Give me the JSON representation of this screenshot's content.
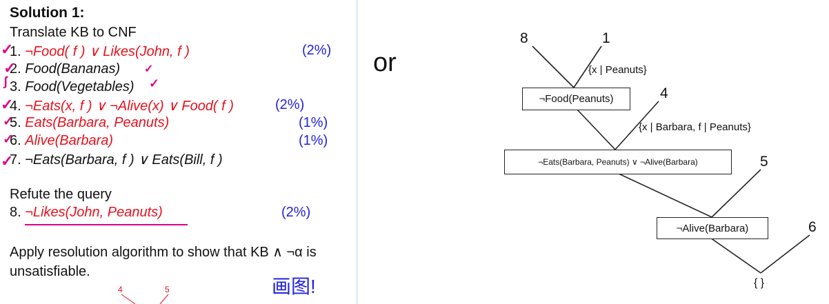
{
  "left": {
    "title": "Solution 1:",
    "subtitle": "Translate KB to CNF",
    "clauses": [
      {
        "num": "1. ",
        "text": "¬Food( f ) ∨ Likes(John, f )",
        "pct": "(2%)"
      },
      {
        "num": "2. ",
        "text": "Food(Bananas)"
      },
      {
        "num": "3. ",
        "text": "Food(Vegetables)"
      },
      {
        "num": "4. ",
        "text": "¬Eats(x, f ) ∨ ¬Alive(x) ∨ Food( f )",
        "pct": "(2%)"
      },
      {
        "num": "5. ",
        "text": "Eats(Barbara, Peanuts)",
        "pct": "(1%)"
      },
      {
        "num": "6. ",
        "text": "Alive(Barbara)",
        "pct": "(1%)"
      },
      {
        "num": "7. ",
        "text": "¬Eats(Barbara, f ) ∨ Eats(Bill, f )"
      }
    ],
    "refute_label": "Refute the query",
    "query": {
      "num": "8. ",
      "text": "¬Likes(John, Peanuts)",
      "pct": "(2%)"
    },
    "apply_line1": "Apply resolution algorithm to show that KB ∧ ¬α is",
    "apply_line2": "unsatisfiable.",
    "handwritten_note": "画图!",
    "mini_tree": {
      "n1": "4",
      "n2": "5"
    }
  },
  "or_word": "or",
  "tree": {
    "nodes": {
      "n8": "8",
      "n1": "1",
      "n4": "4",
      "n5": "5",
      "n6": "6"
    },
    "subs": {
      "s1": "{x | Peanuts}",
      "s2": "{x | Barbara, f | Peanuts}"
    },
    "boxes": {
      "b1": "¬Food(Peanuts)",
      "b2": "¬Eats(Barbara, Peanuts) ∨ ¬Alive(Barbara)",
      "b3": "¬Alive(Barbara)"
    },
    "result": "{ }"
  },
  "colors": {
    "red": "#e8111c",
    "blue": "#2222e0",
    "check": "#e0008a"
  }
}
